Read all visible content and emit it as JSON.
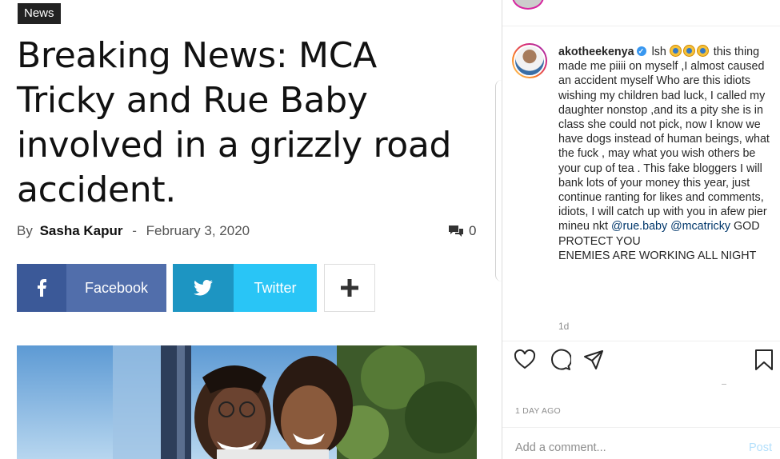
{
  "article": {
    "category": "News",
    "headline": "Breaking News: MCA Tricky and Rue Baby involved in a grizzly road accident.",
    "by_label": "By",
    "author": "Sasha Kapur",
    "separator": "-",
    "date": "February 3, 2020",
    "comment_count": "0",
    "share": {
      "facebook": "Facebook",
      "twitter": "Twitter",
      "more": "+"
    }
  },
  "instagram": {
    "username": "akotheekenya",
    "caption_intro": "lsh",
    "caption_text": " this thing made me piiii on myself ,I almost caused an accident myself Who are this idiots wishing my children bad luck, I called my daughter nonstop ,and its a pity she is in class she could not pick, now I know we have dogs instead of human beings, what the fuck , may what you wish others be your cup of tea . This fake bloggers I will bank lots of your money this year, just continue ranting for likes and comments, idiots, I will catch up with you in afew pier mineu nkt ",
    "mention_1": "@rue.baby",
    "mention_2": "@mcatricky",
    "caption_end_1": " GOD PROTECT YOU",
    "caption_end_2": "ENEMIES ARE WORKING ALL NIGHT",
    "time_short": "1d",
    "time_long": "1 DAY AGO",
    "comment_placeholder": "Add a comment...",
    "post_label": "Post"
  },
  "colors": {
    "facebook_dark": "#3b5998",
    "facebook_light": "#516eab",
    "twitter_dark": "#1d95c2",
    "twitter_light": "#29c5f6",
    "ig_link": "#00376b",
    "ig_post": "#b2dffc"
  },
  "icons": [
    "comment-bubbles-icon",
    "facebook-icon",
    "twitter-icon",
    "plus-icon",
    "verified-badge-icon",
    "heart-icon",
    "comment-icon",
    "share-icon",
    "bookmark-icon"
  ]
}
